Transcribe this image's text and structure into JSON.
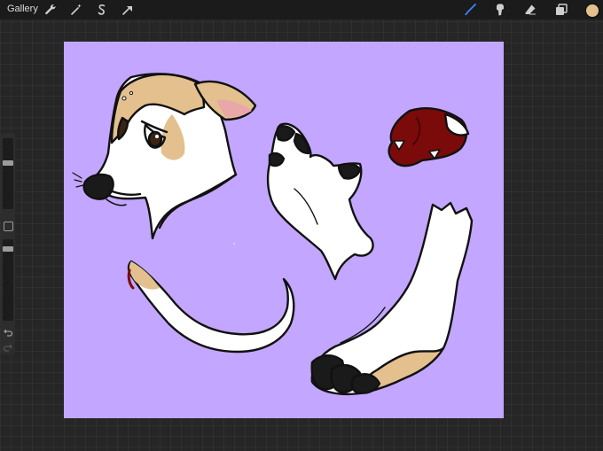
{
  "topbar": {
    "gallery_label": "Gallery",
    "left_tools": [
      "wrench-icon",
      "magic-wand-icon",
      "selection-icon",
      "transform-arrow-icon"
    ],
    "right_tools": [
      "brush-icon",
      "smudge-icon",
      "eraser-icon",
      "layers-icon"
    ],
    "active_tool": "brush-icon",
    "active_color": "#e3c08e"
  },
  "colors": {
    "interface_bg": "#262626",
    "topbar_bg": "#1b1b1b",
    "canvas_bg": "#c3a6ff",
    "coat_tan": "#e3c08e",
    "coat_white": "#ffffff",
    "mouth_red": "#7b0a0a",
    "line": "#111111",
    "active_tool": "#3a86ff"
  },
  "canvas": {
    "artwork_parts": [
      "dog-head",
      "paw",
      "mouth-with-teeth",
      "tail",
      "foreleg-with-hoof-paw"
    ]
  }
}
